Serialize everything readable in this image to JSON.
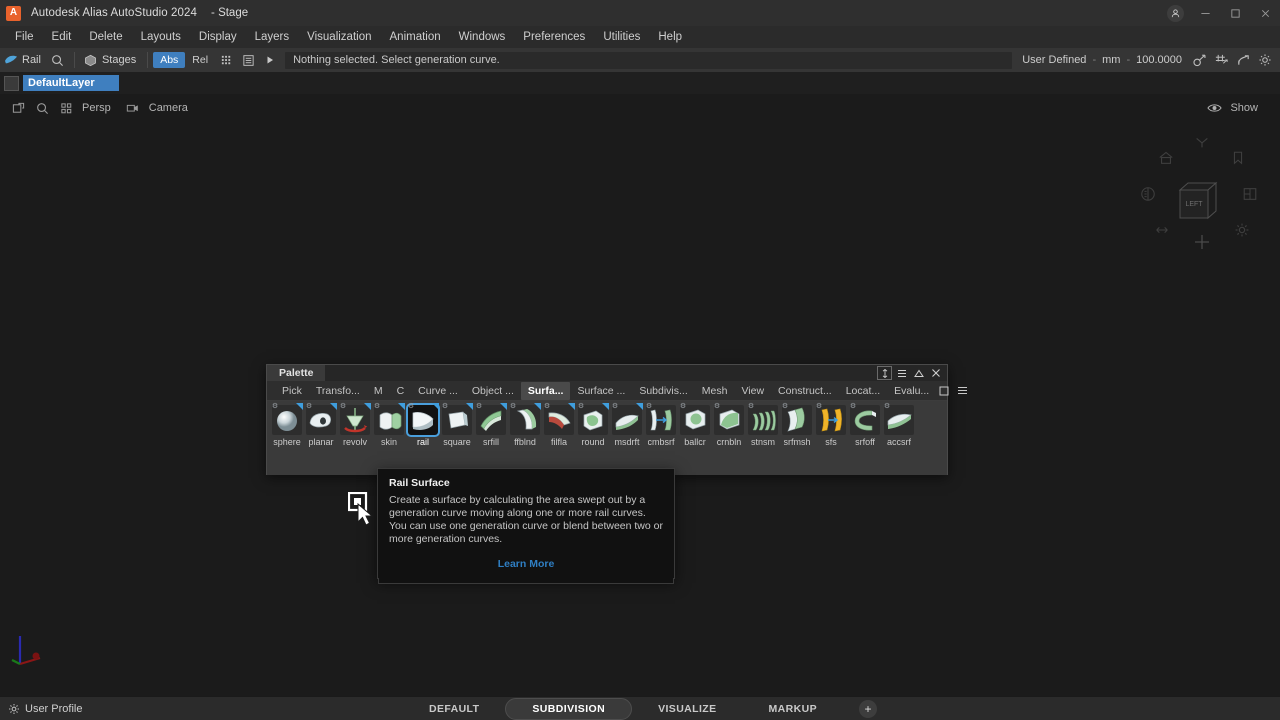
{
  "titlebar": {
    "logo_glyph": "A",
    "app_title": "Autodesk Alias AutoStudio 2024",
    "stage": "- Stage",
    "minimize": "─",
    "maximize": "□",
    "close": "✕"
  },
  "menubar": {
    "items": [
      {
        "label": "File"
      },
      {
        "label": "Edit"
      },
      {
        "label": "Delete"
      },
      {
        "label": "Layouts"
      },
      {
        "label": "Display"
      },
      {
        "label": "Layers"
      },
      {
        "label": "Visualization"
      },
      {
        "label": "Animation"
      },
      {
        "label": "Windows"
      },
      {
        "label": "Preferences"
      },
      {
        "label": "Utilities"
      },
      {
        "label": "Help"
      }
    ]
  },
  "toolbar": {
    "tool_label": "Rail",
    "stages_label": "Stages",
    "abs_label": "Abs",
    "rel_label": "Rel",
    "prompt": "Nothing selected. Select generation curve.",
    "units_mode": "User Defined",
    "units": "mm",
    "units_value": "100.0000",
    "sep": "-"
  },
  "layerbar": {
    "layer_name": "DefaultLayer"
  },
  "viewbar": {
    "persp_label": "Persp",
    "camera_label": "Camera",
    "show_label": "Show"
  },
  "palette": {
    "window_title": "Palette",
    "tabs": [
      {
        "label": "Pick",
        "active": false
      },
      {
        "label": "Transfo...",
        "active": false
      },
      {
        "label": "M",
        "active": false
      },
      {
        "label": "C",
        "active": false
      },
      {
        "label": "Curve ...",
        "active": false
      },
      {
        "label": "Object ...",
        "active": false
      },
      {
        "label": "Surfa...",
        "active": true
      },
      {
        "label": "Surface ...",
        "active": false
      },
      {
        "label": "Subdivis...",
        "active": false
      },
      {
        "label": "Mesh",
        "active": false
      },
      {
        "label": "View",
        "active": false
      },
      {
        "label": "Construct...",
        "active": false
      },
      {
        "label": "Locat...",
        "active": false
      },
      {
        "label": "Evalu...",
        "active": false
      }
    ],
    "tools": [
      {
        "label": "sphere",
        "icon": "sphere-tool-icon",
        "selected": false
      },
      {
        "label": "planar",
        "icon": "planar-tool-icon",
        "selected": false
      },
      {
        "label": "revolv",
        "icon": "revolve-tool-icon",
        "selected": false
      },
      {
        "label": "skin",
        "icon": "skin-tool-icon",
        "selected": false
      },
      {
        "label": "rail",
        "icon": "rail-surface-tool-icon",
        "selected": true
      },
      {
        "label": "square",
        "icon": "square-tool-icon",
        "selected": false
      },
      {
        "label": "srfill",
        "icon": "surface-fillet-tool-icon",
        "selected": false
      },
      {
        "label": "ffblnd",
        "icon": "freeform-blend-tool-icon",
        "selected": false
      },
      {
        "label": "filfla",
        "icon": "fillet-flange-tool-icon",
        "selected": false
      },
      {
        "label": "round",
        "icon": "round-tool-icon",
        "selected": false
      },
      {
        "label": "msdrft",
        "icon": "multi-surface-draft-tool-icon",
        "selected": false
      },
      {
        "label": "cmbsrf",
        "icon": "combine-surfaces-tool-icon",
        "selected": false
      },
      {
        "label": "ballcr",
        "icon": "ball-corner-tool-icon",
        "selected": false
      },
      {
        "label": "crnbln",
        "icon": "corner-blend-tool-icon",
        "selected": false
      },
      {
        "label": "stnsm",
        "icon": "skin-tension-tool-icon",
        "selected": false
      },
      {
        "label": "srfmsh",
        "icon": "surface-mesh-tool-icon",
        "selected": false
      },
      {
        "label": "sfs",
        "icon": "surface-from-surface-tool-icon",
        "selected": false
      },
      {
        "label": "srfoff",
        "icon": "surface-offset-tool-icon",
        "selected": false
      },
      {
        "label": "accsrf",
        "icon": "accuracy-surface-tool-icon",
        "selected": false
      }
    ]
  },
  "tooltip": {
    "title": "Rail Surface",
    "body": "Create a surface by calculating the area swept out by a generation curve moving along one or more rail curves. You can use one generation curve or blend between two or more generation curves.",
    "link": "Learn More"
  },
  "statusbar": {
    "profile_label": "User Profile",
    "workspaces": [
      {
        "label": "DEFAULT",
        "active": false
      },
      {
        "label": "SUBDIVISION",
        "active": true
      },
      {
        "label": "VISUALIZE",
        "active": false
      },
      {
        "label": "MARKUP",
        "active": false
      }
    ],
    "add_label": "+"
  },
  "colors": {
    "accent_blue": "#3f7fbf",
    "selection_outline": "#4a9fdc",
    "brand_orange": "#e8622c",
    "link_blue": "#2f7fc4",
    "panel_bg": "#3a3a3a",
    "app_bg": "#1b1b1b"
  }
}
